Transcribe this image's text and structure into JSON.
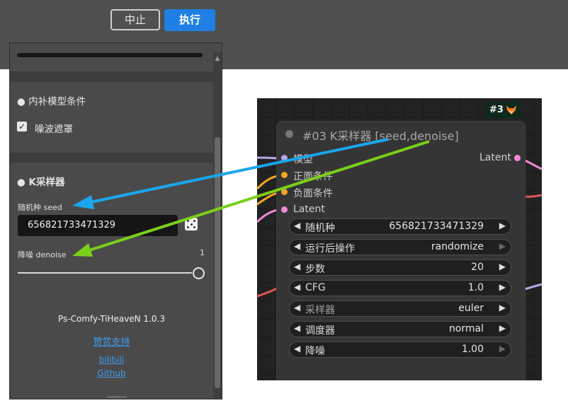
{
  "toolbar": {
    "stop_label": "中止",
    "run_label": "执行"
  },
  "panel": {
    "section_inpaint_title": "● 内补模型条件",
    "noise_mask_label": "噪波遮罩",
    "noise_mask_checked": true,
    "section_ksampler_title": "● K采样器",
    "seed_label": "随机种 seed",
    "seed_value": "656821733471329",
    "denoise_label": "降噪 denoise",
    "denoise_value": "1",
    "denoise_fraction": 1.0,
    "version": "Ps-Comfy-TiHeaveN 1.0.3",
    "support_link": "赞赏支持",
    "bilibili_link": "bilibili",
    "github_link": "Github"
  },
  "node": {
    "badge": "#3",
    "badge_icon": "fox-icon",
    "title": "#03 K采样器 [seed,denoise]",
    "inputs": [
      "模型",
      "正面条件",
      "负面条件",
      "Latent"
    ],
    "output": "Latent",
    "widgets": [
      {
        "label": "随机种",
        "value": "656821733471329"
      },
      {
        "label": "运行后操作",
        "value": "randomize"
      },
      {
        "label": "步数",
        "value": "20"
      },
      {
        "label": "CFG",
        "value": "1.0"
      },
      {
        "label": "采样器",
        "value": "euler"
      },
      {
        "label": "调度器",
        "value": "normal"
      },
      {
        "label": "降噪",
        "value": "1.00"
      }
    ]
  },
  "colors": {
    "run_button": "#1f7fe5",
    "arrow_seed": "#1aa6ee",
    "arrow_denoise": "#7ccf1a",
    "slot_model": "#b9a6e8",
    "slot_conditioning": "#f5a623",
    "slot_latent": "#f58ad8"
  }
}
